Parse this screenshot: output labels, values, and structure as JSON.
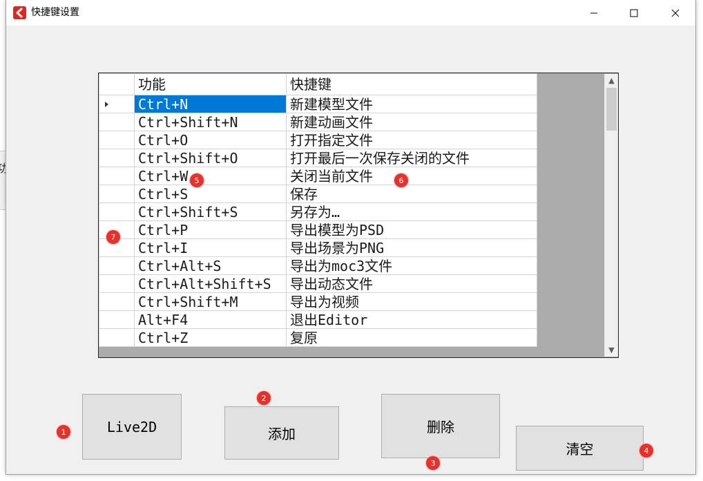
{
  "window": {
    "title": "快捷键设置",
    "minimize_glyph": "—",
    "maximize_glyph": "☐",
    "close_glyph": "✕"
  },
  "background_app": {
    "partial_char": "功"
  },
  "grid": {
    "columns": [
      "功能",
      "快捷键"
    ],
    "rows": [
      {
        "key": "Ctrl+N",
        "action": "新建模型文件"
      },
      {
        "key": "Ctrl+Shift+N",
        "action": "新建动画文件"
      },
      {
        "key": "Ctrl+O",
        "action": "打开指定文件"
      },
      {
        "key": "Ctrl+Shift+O",
        "action": "打开最后一次保存关闭的文件"
      },
      {
        "key": "Ctrl+W",
        "action": "关闭当前文件"
      },
      {
        "key": "Ctrl+S",
        "action": "保存"
      },
      {
        "key": "Ctrl+Shift+S",
        "action": "另存为…"
      },
      {
        "key": "Ctrl+P",
        "action": "导出模型为PSD"
      },
      {
        "key": "Ctrl+I",
        "action": "导出场景为PNG"
      },
      {
        "key": "Ctrl+Alt+S",
        "action": "导出为moc3文件"
      },
      {
        "key": "Ctrl+Alt+Shift+S",
        "action": "导出动态文件"
      },
      {
        "key": "Ctrl+Shift+M",
        "action": "导出为视频"
      },
      {
        "key": "Alt+F4",
        "action": "退出Editor"
      },
      {
        "key": "Ctrl+Z",
        "action": "复原"
      }
    ],
    "selected_row": 0
  },
  "buttons": {
    "live2d": "Live2D",
    "add": "添加",
    "delete": "删除",
    "clear": "清空"
  },
  "markers": [
    "1",
    "2",
    "3",
    "4",
    "5",
    "6",
    "7"
  ],
  "colors": {
    "selection": "#0078d7",
    "marker": "#e5322d",
    "app_icon": "#e0261f"
  }
}
